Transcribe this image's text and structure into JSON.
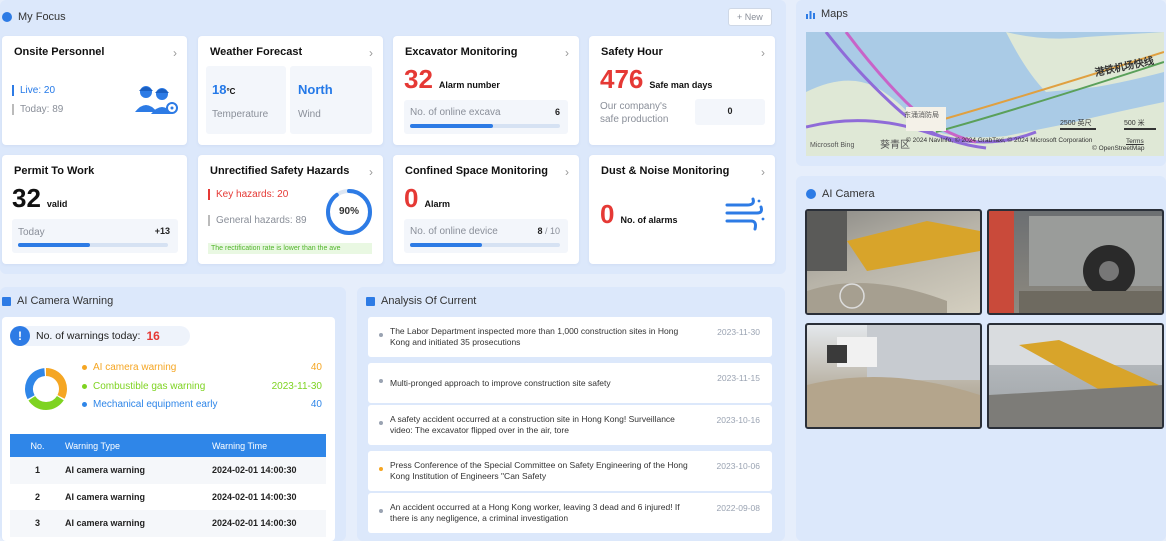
{
  "my_focus": {
    "title": "My Focus",
    "new_label": "+ New"
  },
  "onsite": {
    "title": "Onsite Personnel",
    "live": "Live:  20",
    "today": "Today:  89"
  },
  "weather": {
    "title": "Weather Forecast",
    "temp": "18",
    "temp_unit": "°C",
    "temp_label": "Temperature",
    "wind": "North",
    "wind_label": "Wind"
  },
  "excavator": {
    "title": "Excavator Monitoring",
    "value": "32",
    "value_label": "Alarm number",
    "online_label": "No. of online excava",
    "online_value": "6",
    "progress": 0.55
  },
  "safety_hour": {
    "title": "Safety Hour",
    "value": "476",
    "value_label": "Safe man days",
    "sub_label_1": "Our company's",
    "sub_label_2": "safe production",
    "sub_value": "0"
  },
  "permit": {
    "title": "Permit To Work",
    "value": "32",
    "value_label": "valid",
    "today_label": "Today",
    "today_value": "+13",
    "progress": 0.48
  },
  "hazards": {
    "title": "Unrectified Safety Hazards",
    "key": "Key hazards: 20",
    "general": "General hazards:  89",
    "percent": "90%",
    "percent_value": 0.9,
    "note": "The rectification rate is lower than the ave"
  },
  "confined": {
    "title": "Confined Space Monitoring",
    "value": "0",
    "value_label": "Alarm",
    "online_label": "No. of online device",
    "online_value": "8",
    "online_total": "/ 10",
    "progress": 0.48
  },
  "dust": {
    "title": "Dust & Noise Monitoring",
    "value": "0",
    "value_label": "No. of alarms"
  },
  "maps": {
    "title": "Maps",
    "credit": "© 2024 NavInfo, © 2024 GrabTaxi, © 2024 Microsoft Corporation",
    "terms": "Terms",
    "osm": "© OpenStreetMap",
    "scale1": "2500 英尺",
    "scale2": "500 米",
    "road_label": "港铁机场快线",
    "district_label": "葵青区",
    "place_label": "东涌消防局",
    "bing": "Microsoft Bing"
  },
  "ai_camera": {
    "title": "AI Camera"
  },
  "warning": {
    "title": "AI Camera Warning",
    "count_label": "No. of warnings today:",
    "count": "16",
    "legend": [
      {
        "label": "AI camera warning",
        "value": "40",
        "color": "#f5a623"
      },
      {
        "label": "Combustible gas warning",
        "value": "2023-11-30",
        "color": "#7ed321"
      },
      {
        "label": "Mechanical equipment early",
        "value": "40",
        "color": "#2f86e8"
      }
    ],
    "donut": [
      0.34,
      0.33,
      0.33
    ],
    "table_headers": [
      "No.",
      "Warning Type",
      "Warning Time"
    ],
    "rows": [
      [
        "1",
        "AI camera warning",
        "2024-02-01 14:00:30"
      ],
      [
        "2",
        "AI camera warning",
        "2024-02-01 14:00:30"
      ],
      [
        "3",
        "AI camera warning",
        "2024-02-01 14:00:30"
      ]
    ]
  },
  "analysis": {
    "title": "Analysis Of Current",
    "items": [
      {
        "text": "The Labor Department inspected more than 1,000 construction sites in Hong Kong and initiated 35 prosecutions",
        "date": "2023-11-30",
        "dot": "#9aa3b2"
      },
      {
        "text": "Multi-pronged approach to improve construction site safety",
        "date": "2023-11-15",
        "dot": "#9aa3b2"
      },
      {
        "text": "A safety accident occurred at a construction site in Hong Kong! Surveillance video: The excavator flipped over in the air, tore",
        "date": "2023-10-16",
        "dot": "#9aa3b2"
      },
      {
        "text": "Press Conference of the Special Committee on Safety Engineering of the Hong Kong Institution of Engineers \"Can Safety",
        "date": "2023-10-06",
        "dot": "#f5a623"
      },
      {
        "text": "An accident occurred at a Hong Kong worker, leaving 3 dead and 6 injured! If there is any negligence, a criminal investigation",
        "date": "2022-09-08",
        "dot": "#9aa3b2"
      }
    ]
  }
}
